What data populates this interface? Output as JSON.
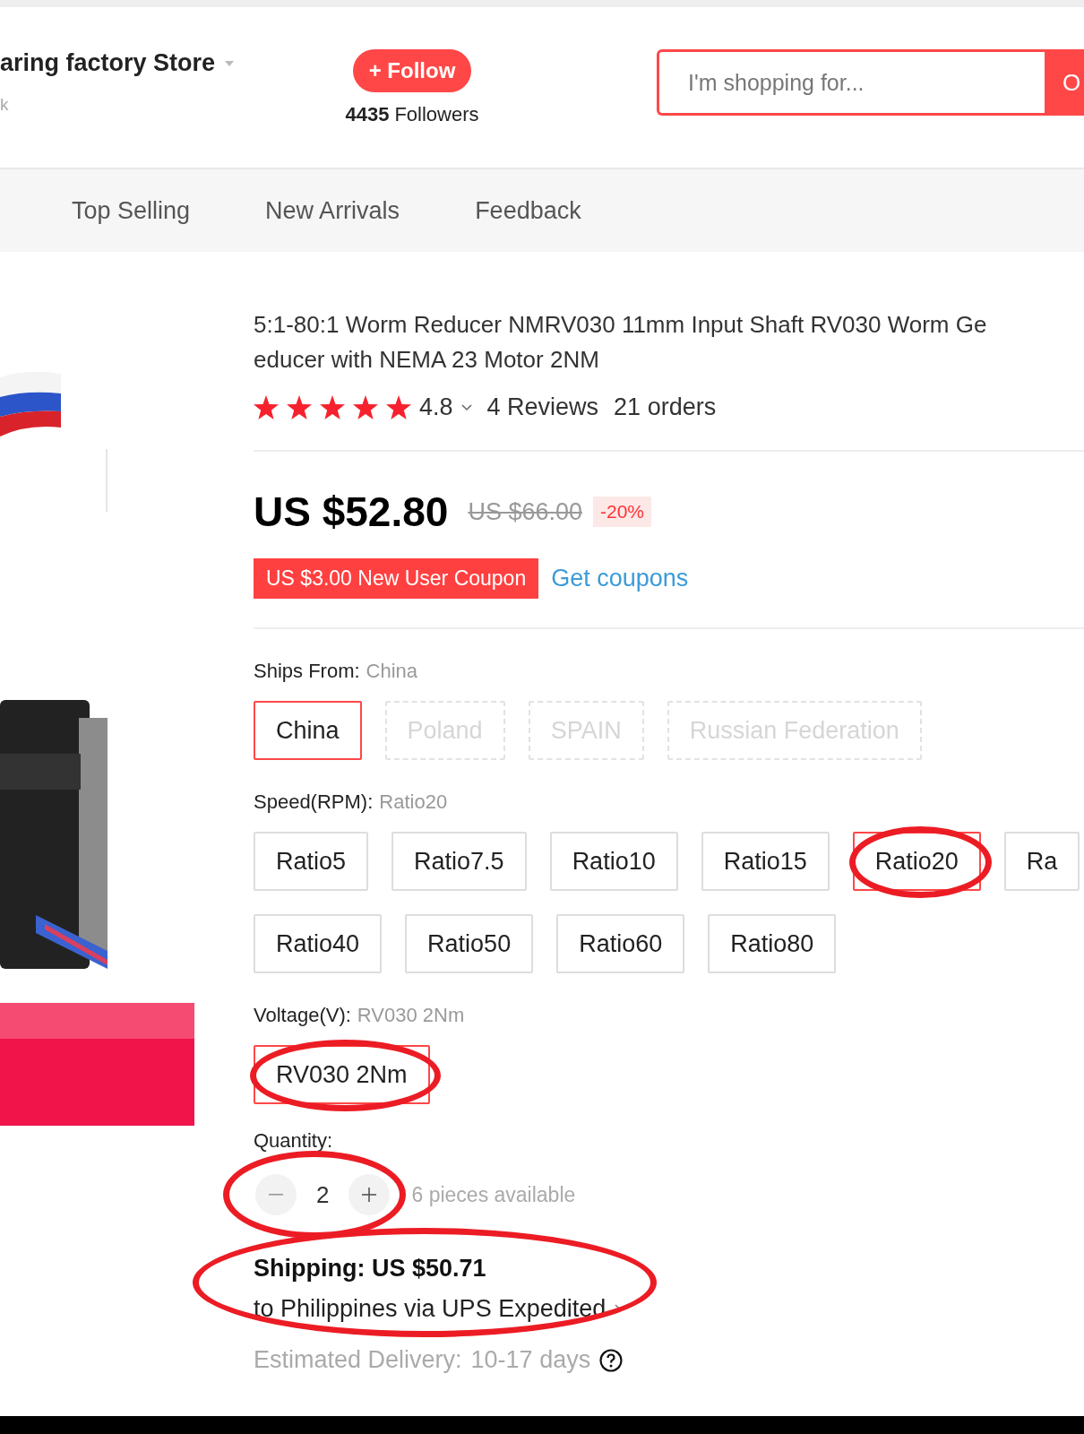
{
  "store": {
    "name": "aring factory Store",
    "subline": "k",
    "follow_button": "+ Follow",
    "followers_count": "4435",
    "followers_label": "Followers"
  },
  "search": {
    "placeholder": "I'm shopping for...",
    "button": "O"
  },
  "nav": [
    "Top Selling",
    "New Arrivals",
    "Feedback"
  ],
  "product": {
    "title_lines": [
      "5:1-80:1 Worm Reducer NMRV030 11mm Input Shaft RV030 Worm Ge",
      "educer with NEMA 23 Motor 2NM"
    ],
    "stars": 5,
    "rating": "4.8",
    "reviews": "4 Reviews",
    "orders": "21 orders",
    "price": "US $52.80",
    "original_price": "US $66.00",
    "discount": "-20%",
    "coupon": "US $3.00 New User Coupon",
    "get_coupons": "Get coupons"
  },
  "option_groups": [
    {
      "label": "Ships From:",
      "value": "China",
      "items": [
        {
          "label": "China",
          "selected": true,
          "disabled": false,
          "circled": false
        },
        {
          "label": "Poland",
          "selected": false,
          "disabled": true,
          "circled": false
        },
        {
          "label": "SPAIN",
          "selected": false,
          "disabled": true,
          "circled": false
        },
        {
          "label": "Russian Federation",
          "selected": false,
          "disabled": true,
          "circled": false
        }
      ]
    },
    {
      "label": "Speed(RPM):",
      "value": "Ratio20",
      "items": [
        {
          "label": "Ratio5",
          "selected": false,
          "disabled": false,
          "circled": false
        },
        {
          "label": "Ratio7.5",
          "selected": false,
          "disabled": false,
          "circled": false
        },
        {
          "label": "Ratio10",
          "selected": false,
          "disabled": false,
          "circled": false
        },
        {
          "label": "Ratio15",
          "selected": false,
          "disabled": false,
          "circled": false
        },
        {
          "label": "Ratio20",
          "selected": true,
          "disabled": false,
          "circled": true
        },
        {
          "label": "Ra",
          "selected": false,
          "disabled": false,
          "circled": false
        },
        {
          "label": "Ratio40",
          "selected": false,
          "disabled": false,
          "circled": false
        },
        {
          "label": "Ratio50",
          "selected": false,
          "disabled": false,
          "circled": false
        },
        {
          "label": "Ratio60",
          "selected": false,
          "disabled": false,
          "circled": false
        },
        {
          "label": "Ratio80",
          "selected": false,
          "disabled": false,
          "circled": false
        }
      ]
    },
    {
      "label": "Voltage(V):",
      "value": "RV030 2Nm",
      "items": [
        {
          "label": "RV030 2Nm",
          "selected": true,
          "disabled": false,
          "circled": true
        }
      ]
    }
  ],
  "quantity": {
    "label": "Quantity:",
    "value": "2",
    "available": "6 pieces available",
    "circled": true
  },
  "shipping": {
    "cost": "Shipping: US $50.71",
    "route": "to Philippines via UPS Expedited",
    "circled": true,
    "delivery_label": "Estimated Delivery:",
    "delivery_days": "10-17 days"
  }
}
